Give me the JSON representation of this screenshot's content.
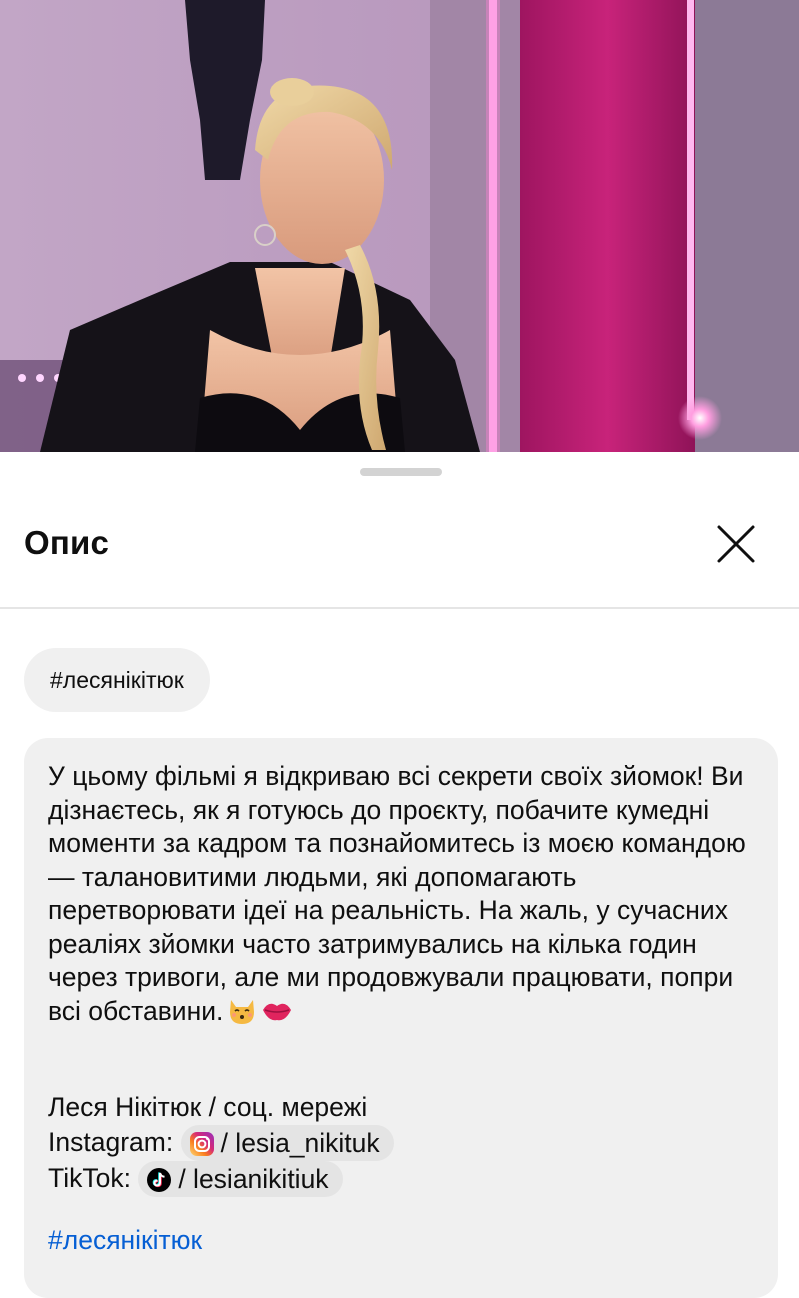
{
  "sheet": {
    "title": "Опис",
    "close_icon": "close-icon"
  },
  "hashtag_chip": "#лесянікітюк",
  "description": {
    "paragraph": "У цьому фільмі я відкриваю всі секрети своїх зйомок! Ви дізнаєтесь, як я готуюсь до проєкту, побачите кумедні моменти за кадром та познайомитесь із моєю командою — талановитими людьми, які допомагають перетворювати ідеї на реальність. На жаль, у сучасних реаліях зйомки часто затримувались на кілька годин через тривоги, але ми продовжували працювати, попри всі обставини.",
    "emojis": [
      "kissing-cat-emoji",
      "kiss-mark-emoji"
    ],
    "credits_heading": "Леся Нікітюк / соц. мережі",
    "instagram_label": "Instagram:",
    "instagram_handle": "/ lesia_nikituk",
    "tiktok_label": "TikTok:",
    "tiktok_handle": "/ lesianikitiuk",
    "hashtag_link": "#лесянікітюк"
  },
  "colors": {
    "link": "#065fd4",
    "chip_bg": "#f0f0f0",
    "card_bg": "#f0f0f0"
  }
}
